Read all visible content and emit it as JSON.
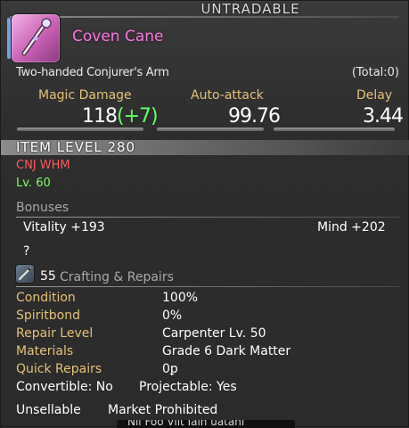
{
  "header": {
    "tradability": "UNTRADABLE",
    "item_name": "Coven Cane",
    "item_type": "Two-handed Conjurer's Arm",
    "total": "(Total:0)",
    "icon": "staff-icon"
  },
  "stats": {
    "magic_damage": {
      "label": "Magic Damage",
      "base": "118",
      "bonus": "(+7)"
    },
    "auto_attack": {
      "label": "Auto-attack",
      "value": "99.76"
    },
    "delay": {
      "label": "Delay",
      "value": "3.44"
    }
  },
  "item_level": "ITEM LEVEL 280",
  "class_jobs": "CNJ WHM",
  "equip_level": "Lv. 60",
  "bonuses": {
    "header": "Bonuses",
    "vitality": "Vitality +193",
    "mind": "Mind +202",
    "unknown": "?"
  },
  "crafting": {
    "level": "55",
    "header": "Crafting & Repairs",
    "icon": "needle-icon",
    "rows": [
      {
        "label": "Condition",
        "value": "100%"
      },
      {
        "label": "Spiritbond",
        "value": "0%"
      },
      {
        "label": "Repair Level",
        "value": "Carpenter Lv. 50"
      },
      {
        "label": "Materials",
        "value": "Grade 6 Dark Matter"
      },
      {
        "label": "Quick Repairs",
        "value": "0ꝑ"
      }
    ],
    "convertible": "Convertible: No",
    "projectable": "Projectable: Yes"
  },
  "flags": {
    "unsellable": "Unsellable",
    "market": "Market Prohibited"
  },
  "footer_partial": "Nil Foo Vilt Iain uatahl"
}
